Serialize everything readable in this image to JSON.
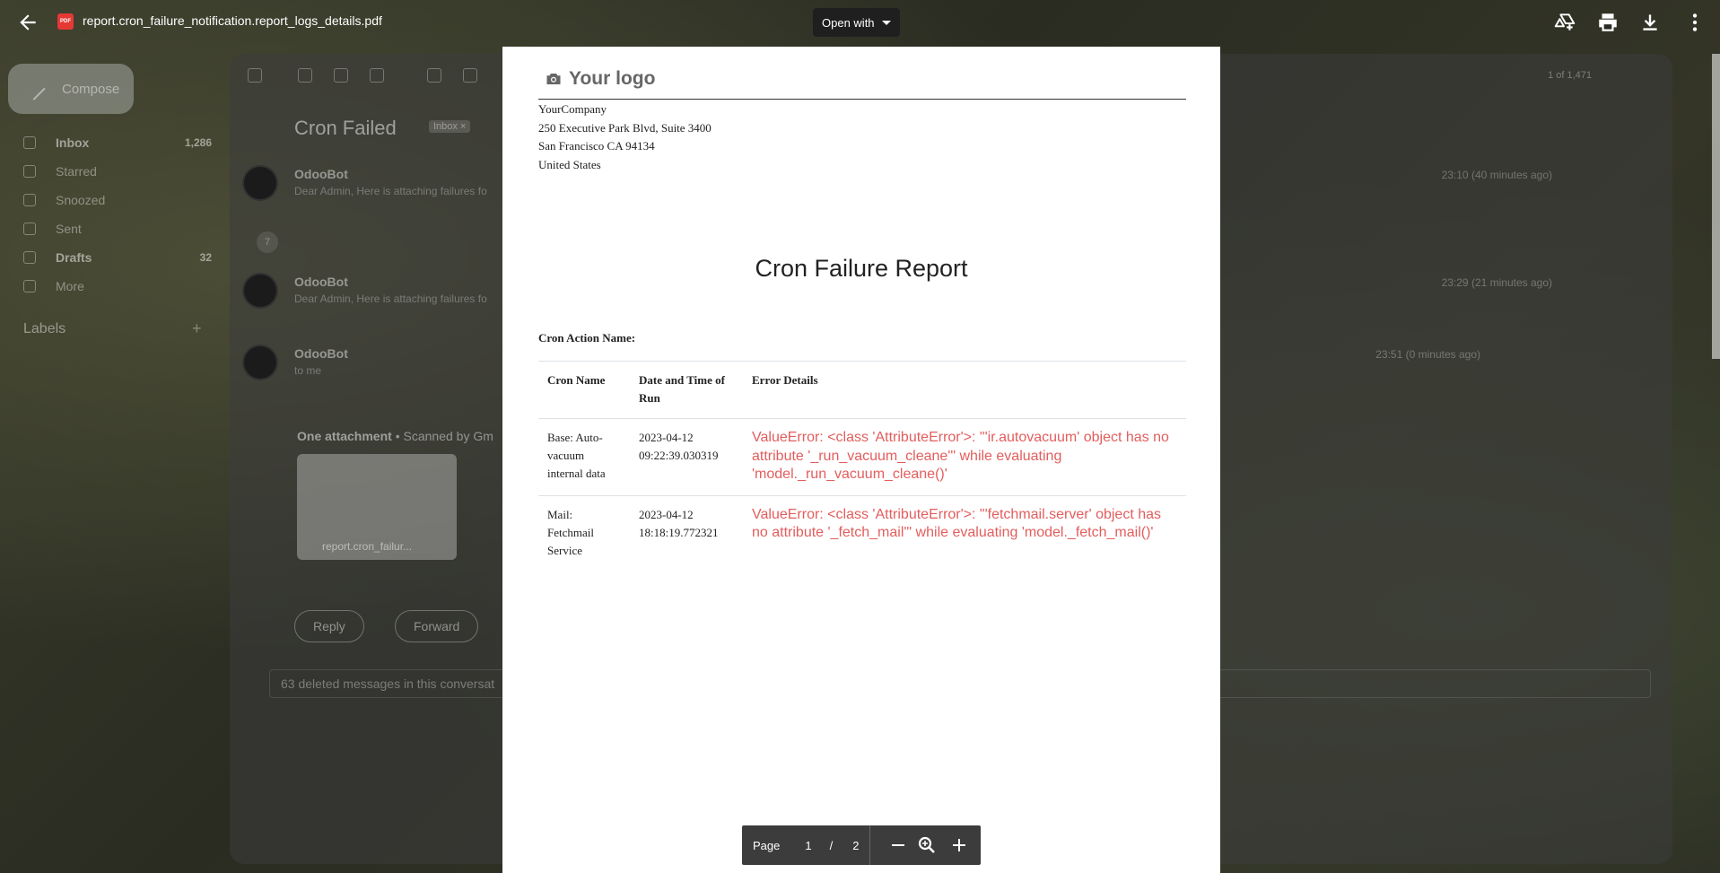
{
  "viewer": {
    "file_name": "report.cron_failure_notification.report_logs_details.pdf",
    "pdf_badge": "PDF",
    "open_with_label": "Open with"
  },
  "gmail": {
    "compose_label": "Compose",
    "nav": [
      {
        "label": "Inbox",
        "count": "1,286"
      },
      {
        "label": "Starred",
        "count": ""
      },
      {
        "label": "Snoozed",
        "count": ""
      },
      {
        "label": "Sent",
        "count": ""
      },
      {
        "label": "Drafts",
        "count": "32"
      },
      {
        "label": "More",
        "count": ""
      }
    ],
    "labels_heading": "Labels",
    "pager_count": "1 of 1,471",
    "subject": "Cron Failed",
    "subject_badge": "Inbox ×",
    "messages": [
      {
        "from": "OdooBot",
        "snippet": "Dear Admin, Here is attaching failures fo",
        "time": "23:10 (40 minutes ago)"
      },
      {
        "from": "OdooBot",
        "snippet": "Dear Admin, Here is attaching failures fo",
        "time": "23:29 (21 minutes ago)"
      },
      {
        "from": "OdooBot",
        "snippet": "to me",
        "time": "23:51 (0 minutes ago)"
      }
    ],
    "collapsed_count": "7",
    "attachment_heading": "One attachment",
    "attachment_scan": "• Scanned by Gm",
    "attachment_name": "report.cron_failur...",
    "reply_label": "Reply",
    "forward_label": "Forward",
    "deleted_note": "63 deleted messages in this conversat"
  },
  "report": {
    "logo_text": "Your logo",
    "company": [
      "YourCompany",
      "250 Executive Park Blvd, Suite 3400",
      "San Francisco CA 94134",
      "United States"
    ],
    "title": "Cron Failure Report",
    "cron_action_label": "Cron Action Name:",
    "columns": [
      "Cron Name",
      "Date and Time of Run",
      "Error Details"
    ],
    "rows": [
      {
        "name": "Base: Auto-vacuum internal data",
        "datetime": "2023-04-12 09:22:39.030319",
        "error": "ValueError: <class 'AttributeError'>: \"'ir.autovacuum' object has no attribute '_run_vacuum_cleane'\" while evaluating 'model._run_vacuum_cleane()'"
      },
      {
        "name": "Mail: Fetchmail Service",
        "datetime": "2023-04-12 18:18:19.772321",
        "error": "ValueError: <class 'AttributeError'>: \"'fetchmail.server' object has no attribute '_fetch_mail'\" while evaluating 'model._fetch_mail()'"
      }
    ]
  },
  "pager": {
    "label": "Page",
    "current": "1",
    "separator": "/",
    "total": "2"
  },
  "colors": {
    "error_text": "#e35d5d",
    "pdf_badge": "#e53935",
    "toolbar_bg": "#3c3c3c"
  }
}
